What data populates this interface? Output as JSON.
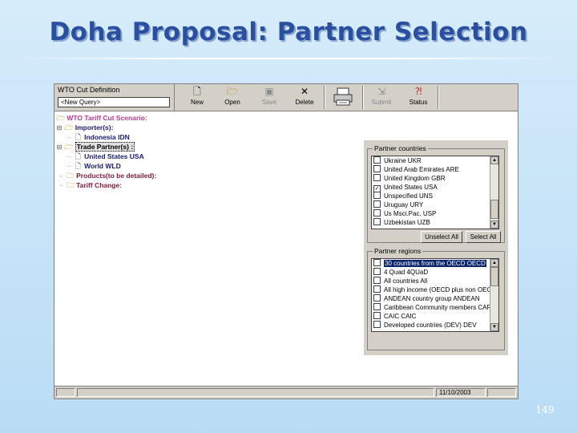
{
  "slide": {
    "title": "Doha Proposal: Partner Selection",
    "page_number": "149"
  },
  "definition": {
    "label": "WTO Cut Definition",
    "selected": "<New Query>"
  },
  "toolbar": {
    "buttons": [
      {
        "label": "New",
        "icon": "new-document-icon",
        "enabled": true
      },
      {
        "label": "Open",
        "icon": "open-folder-icon",
        "enabled": true
      },
      {
        "label": "Save",
        "icon": "save-disk-icon",
        "enabled": false
      },
      {
        "label": "Delete",
        "icon": "delete-x-icon",
        "enabled": true
      },
      {
        "label": "",
        "icon": "printer-icon",
        "enabled": true
      },
      {
        "label": "Submit",
        "icon": "submit-icon",
        "enabled": false
      },
      {
        "label": "Status",
        "icon": "status-icon",
        "enabled": true
      }
    ]
  },
  "tree": {
    "root": "WTO Tariff Cut Scenario:",
    "importers_label": "Importer(s):",
    "importer_1": "Indonesia",
    "importer_1_code": "IDN",
    "partners_label": "Trade Partner(s) :",
    "partner_1": "United States",
    "partner_1_code": "USA",
    "partner_2": "World",
    "partner_2_code": "WLD",
    "products_label": "Products(to be detailed):",
    "tariff_label": "Tariff Change:"
  },
  "partner_countries": {
    "title": "Partner countries",
    "items": [
      {
        "label": "Ukraine  UKR",
        "checked": false
      },
      {
        "label": "United Arab Emirates  ARE",
        "checked": false
      },
      {
        "label": "United Kingdom  GBR",
        "checked": false
      },
      {
        "label": "United States  USA",
        "checked": true
      },
      {
        "label": "Unspecified  UNS",
        "checked": false
      },
      {
        "label": "Uruguay  URY",
        "checked": false
      },
      {
        "label": "Us Msci.Pac.  USP",
        "checked": false
      },
      {
        "label": "Uzbekistan  UZB",
        "checked": false
      }
    ],
    "unselect_all": "Unselect All",
    "select_all": "Select All"
  },
  "partner_regions": {
    "title": "Partner regions",
    "items": [
      {
        "label": "30 countries from the OECD  OECD",
        "checked": false,
        "selected": true
      },
      {
        "label": "4 Quad  4QUaD",
        "checked": false,
        "selected": false
      },
      {
        "label": "All countries  All",
        "checked": false,
        "selected": false
      },
      {
        "label": "All high income (OECD plus non OEC",
        "checked": false,
        "selected": false
      },
      {
        "label": "ANDEAN country group  ANDEAN",
        "checked": false,
        "selected": false
      },
      {
        "label": "Caribbean Community members  CAF",
        "checked": false,
        "selected": false
      },
      {
        "label": "CAIC  CAIC",
        "checked": false,
        "selected": false
      },
      {
        "label": "Developed countries (DEV)  DEV",
        "checked": false,
        "selected": false
      }
    ]
  },
  "statusbar": {
    "date": "11/10/2003"
  },
  "colors": {
    "title": "#2a4fa0",
    "selection": "#0a246a",
    "panel": "#d4d0c8"
  }
}
